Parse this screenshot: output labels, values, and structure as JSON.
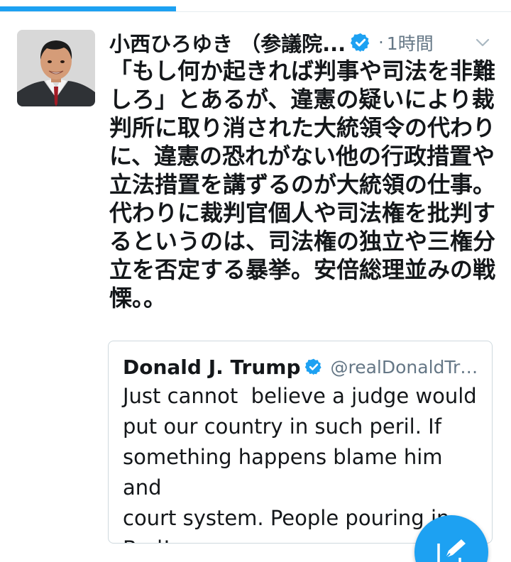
{
  "progress": {
    "fraction": 0.345,
    "color": "#1da1f2"
  },
  "tweet": {
    "author_name": "小西ひろゆき （参議院...",
    "separator": "·",
    "time": "1時間",
    "text": "「もし何か起きれば判事や司法を非難しろ」とあるが、違憲の疑いにより裁判所に取り消された大統領令の代わりに、違憲の恐れがない他の行政措置や立法措置を講ずるのが大統領の仕事。代わりに裁判官個人や司法権を批判するというのは、司法権の独立や三権分立を否定する暴挙。安倍総理並みの戦慄。。"
  },
  "quote": {
    "name": "Donald J. Trump",
    "handle": "@realDonaldTru...",
    "text": "Just cannot  believe a judge would\nput our country in such peril. If\nsomething happens blame him and\ncourt system. People pouring in.\nBad!"
  },
  "icons": {
    "avatar": "avatar-photo",
    "verified": "verified-badge-icon",
    "caret": "chevron-down-icon",
    "compose": "compose-tweet-icon"
  },
  "colors": {
    "accent": "#1da1f2",
    "text": "#14171a",
    "secondary": "#657786",
    "border": "#cfd9de"
  }
}
